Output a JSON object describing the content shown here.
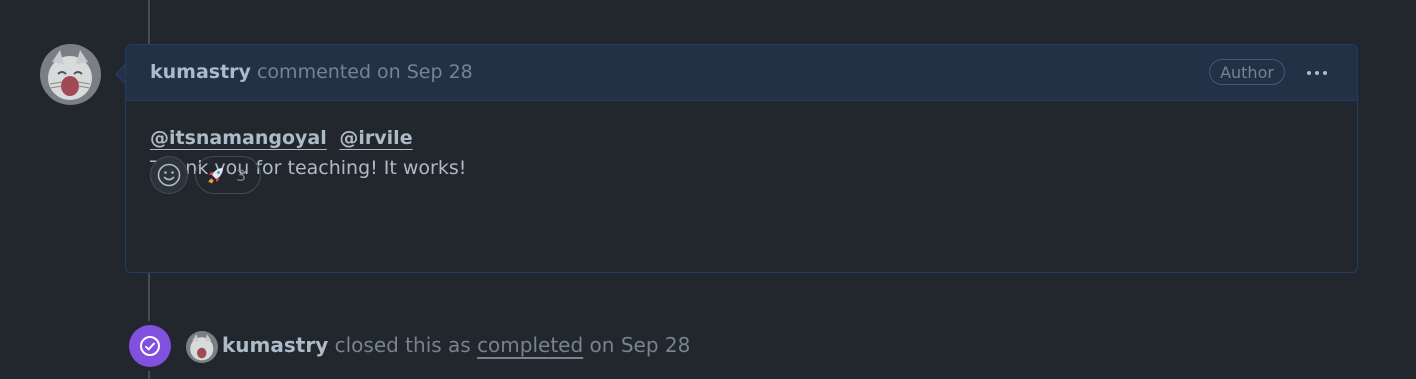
{
  "comment": {
    "author": "kumastry",
    "action": "commented on Sep 28",
    "badge": "Author",
    "mentions": [
      "@itsnamangoyal",
      "@irvile"
    ],
    "body": "Thank you for teaching! It works!",
    "reactions": [
      {
        "emoji": "rocket-icon",
        "count": "3"
      }
    ]
  },
  "event": {
    "actor": "kumastry",
    "text_before": "closed this as",
    "status_link": "completed",
    "text_after": "on Sep 28"
  },
  "colors": {
    "background": "#22272e",
    "header_background": "#243046",
    "accent_border": "#1f3c66",
    "closed_purple": "#8250df"
  }
}
